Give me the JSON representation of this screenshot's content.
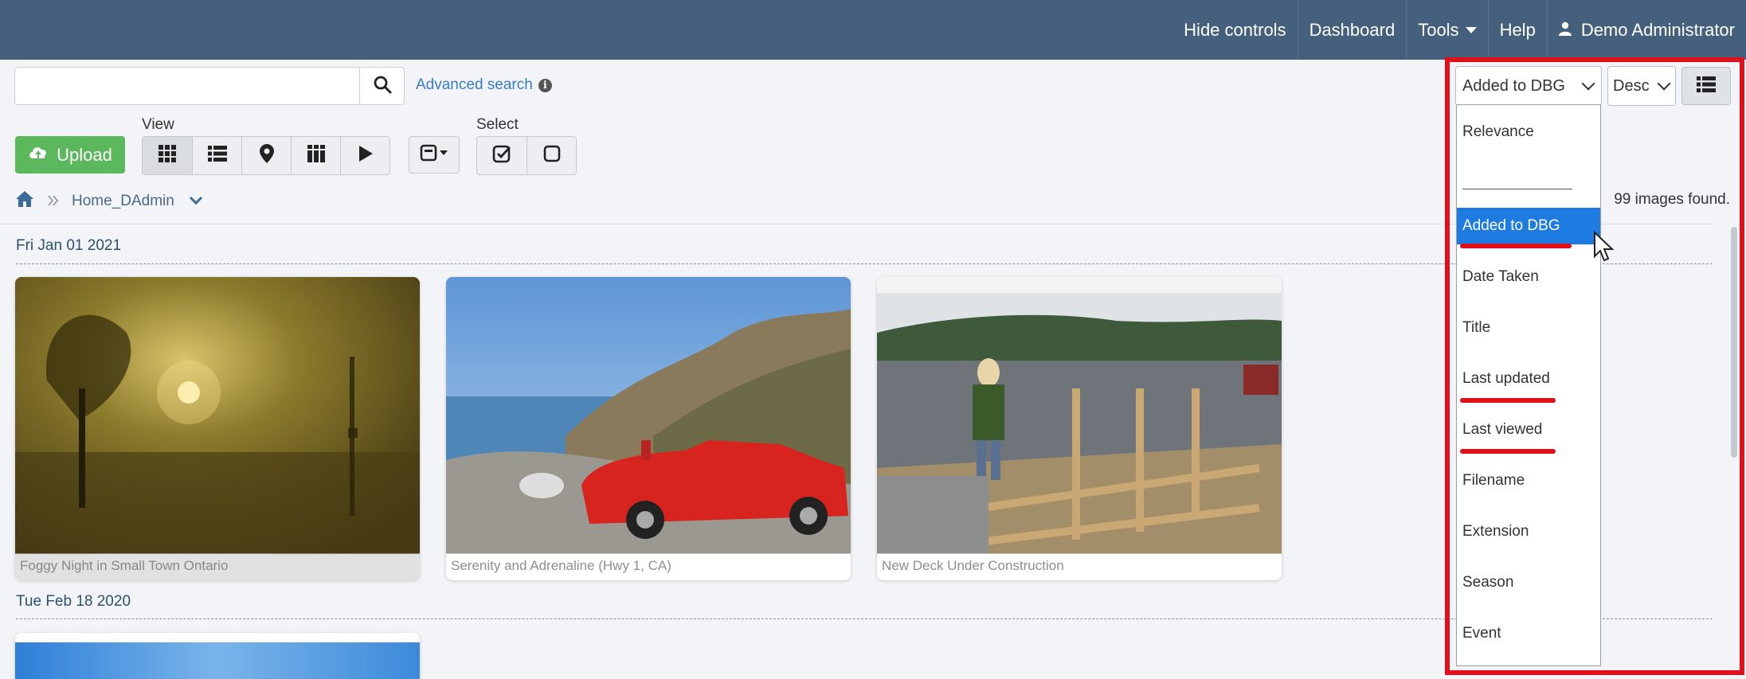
{
  "topnav": {
    "hide_controls": "Hide controls",
    "dashboard": "Dashboard",
    "tools": "Tools",
    "help": "Help",
    "user": "Demo Administrator"
  },
  "search": {
    "placeholder": "",
    "value": "",
    "advanced_label": "Advanced search"
  },
  "toolbar": {
    "upload_label": "Upload",
    "view_label": "View",
    "select_label": "Select"
  },
  "breadcrumb": {
    "current": "Home_DAdmin"
  },
  "results": {
    "count_text": "99 images found."
  },
  "sort": {
    "selected": "Added to DBG",
    "direction": "Desc",
    "options": [
      "Relevance",
      "Added to DBG",
      "Date Taken",
      "Title",
      "Last updated",
      "Last viewed",
      "Filename",
      "Extension",
      "Season",
      "Event"
    ]
  },
  "groups": [
    {
      "date": "Fri Jan 01 2021",
      "images": [
        {
          "title": "Foggy Night in Small Town Ontario"
        },
        {
          "title": "Serenity and Adrenaline (Hwy 1, CA)"
        },
        {
          "title": "New Deck Under Construction"
        }
      ]
    },
    {
      "date": "Tue Feb 18 2020",
      "images": []
    }
  ],
  "colors": {
    "topbar": "#44607c",
    "upload": "#5cb85c",
    "selected_option": "#1e7be2",
    "annotation_red": "#e0101a",
    "link": "#3a7bc8"
  },
  "icons": [
    "search-icon",
    "info-icon",
    "upload-cloud-icon",
    "grid-icon",
    "list-icon",
    "map-pin-icon",
    "columns-icon",
    "play-icon",
    "box-menu-icon",
    "check-square-icon",
    "square-icon",
    "home-icon",
    "chevron-down-icon",
    "user-icon",
    "list-view-icon",
    "cursor-icon"
  ]
}
